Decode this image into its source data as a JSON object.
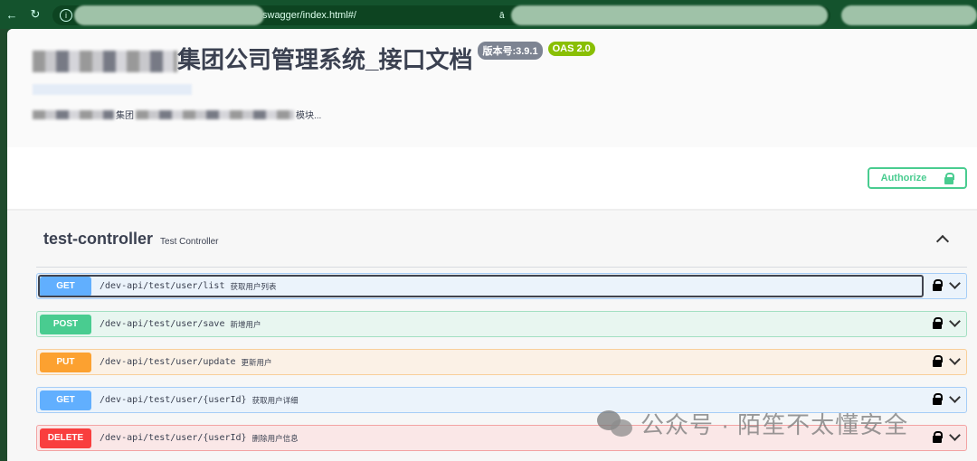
{
  "browser": {
    "url_visible": "swagger/index.html#/",
    "reader_icon": "ā"
  },
  "info": {
    "title": "集团公司管理系统_接口文档",
    "version_badge": "版本号:3.9.1",
    "oas_badge": "OAS 2.0",
    "desc_mid": "集团",
    "desc_end": "模块..."
  },
  "auth": {
    "label": "Authorize"
  },
  "controller": {
    "name": "test-controller",
    "description": "Test Controller"
  },
  "operations": [
    {
      "method": "GET",
      "path": "/dev-api/test/user/list",
      "summary": "获取用户列表",
      "color": "#61affe",
      "bg": "#ebf3fb",
      "border": "#a6cdf7"
    },
    {
      "method": "POST",
      "path": "/dev-api/test/user/save",
      "summary": "新增用户",
      "color": "#49cc90",
      "bg": "#e8f6f0",
      "border": "#a3dfc2"
    },
    {
      "method": "PUT",
      "path": "/dev-api/test/user/update",
      "summary": "更新用户",
      "color": "#fca130",
      "bg": "#fbf1e6",
      "border": "#f9cf9a"
    },
    {
      "method": "GET",
      "path": "/dev-api/test/user/{userId}",
      "summary": "获取用户详细",
      "color": "#61affe",
      "bg": "#ebf3fb",
      "border": "#a6cdf7"
    },
    {
      "method": "DELETE",
      "path": "/dev-api/test/user/{userId}",
      "summary": "删除用户信息",
      "color": "#f93e3e",
      "bg": "#fae7e7",
      "border": "#f3a3a3"
    }
  ],
  "watermark": "公众号 · 陌笙不太懂安全"
}
